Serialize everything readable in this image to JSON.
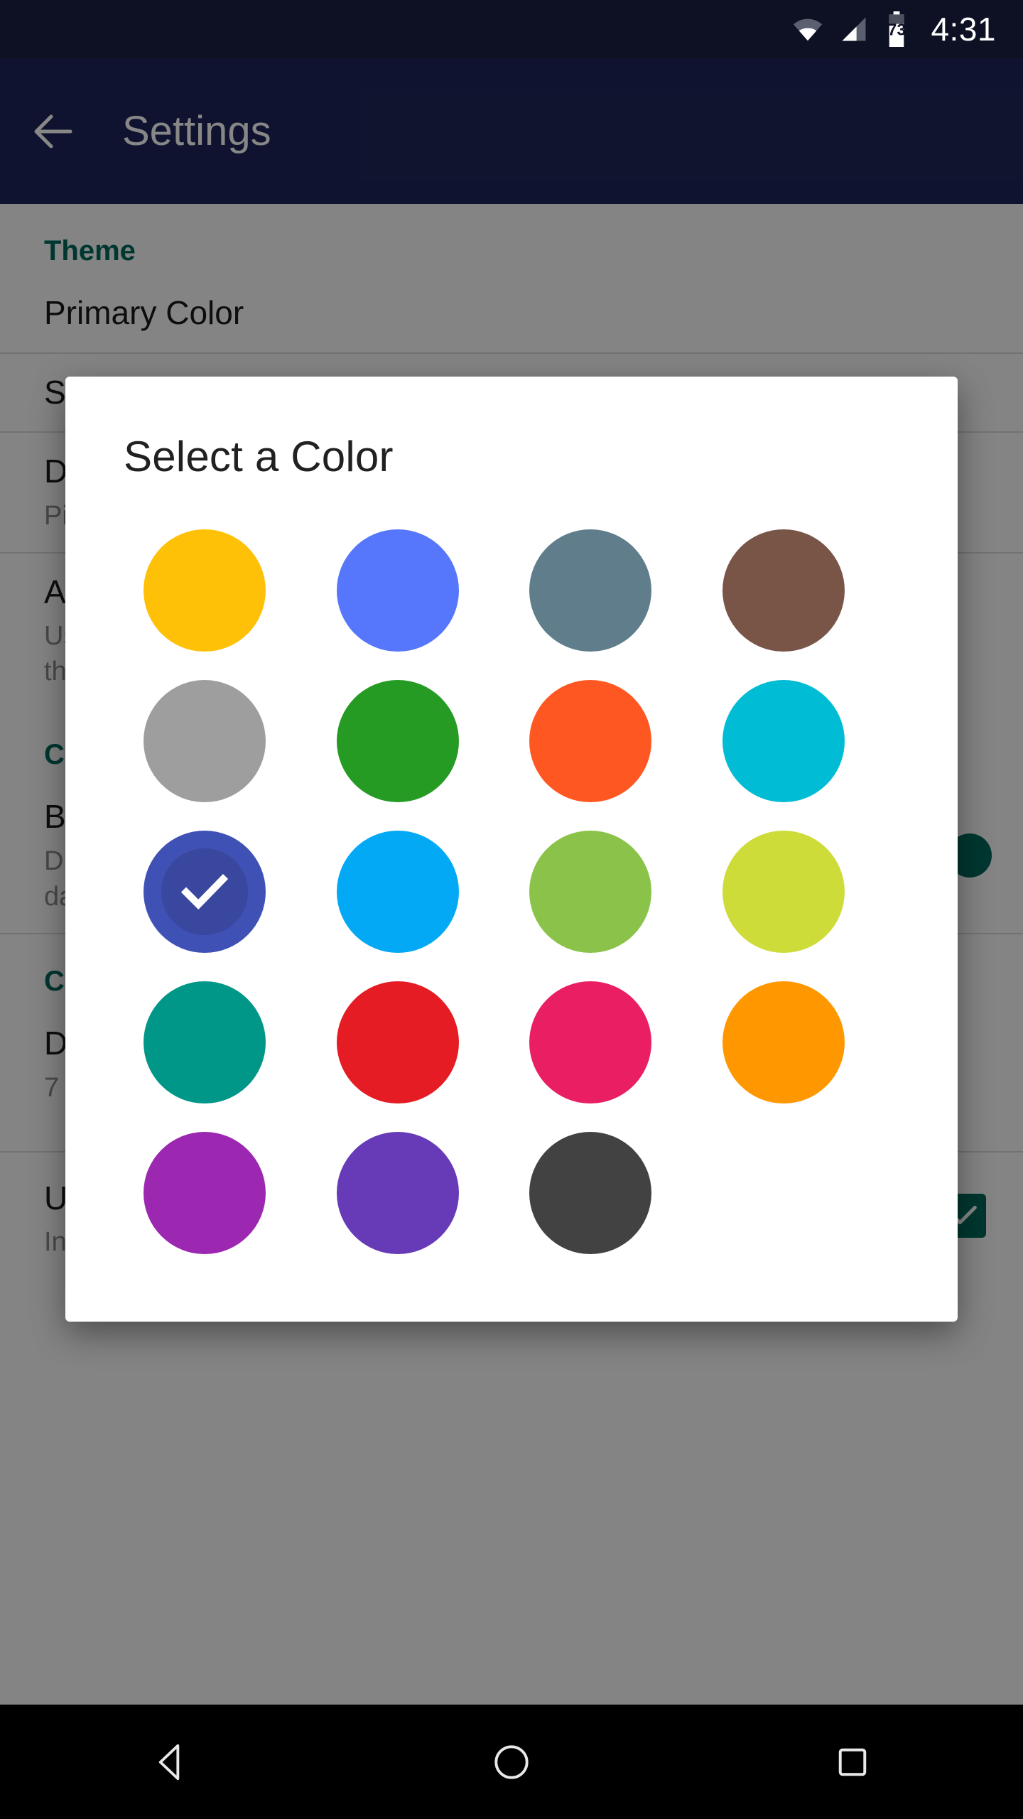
{
  "statusbar": {
    "time": "4:31",
    "battery_level": "73",
    "wifi_icon": "wifi-icon",
    "signal_icon": "cellular-signal-icon",
    "battery_icon": "battery-icon"
  },
  "toolbar": {
    "title": "Settings",
    "back_icon": "back-arrow-icon",
    "background_color": "#1e2559"
  },
  "settings": {
    "section_theme": "Theme",
    "section_color": "Color",
    "section_calendar": "Calendar view setting",
    "rows": [
      {
        "title": "Primary Color",
        "subtitle": ""
      },
      {
        "title": "Secondary Color",
        "subtitle": ""
      },
      {
        "title": "Default Event Color",
        "subtitle": "Pick a color for new events"
      },
      {
        "title": "Automatic Dark Theme",
        "subtitle": "Use dark theme automatically at night using\nthe device settings"
      },
      {
        "title": "Bold Text",
        "subtitle": "Display event titles and headers with bold\ndate text"
      },
      {
        "title": "Days in Week View",
        "subtitle": "7"
      },
      {
        "title": "Use Natural Language",
        "subtitle": "Insert events using Natural Language Processing"
      }
    ],
    "section_header_color": "#00695c",
    "accent_color": "#00695c"
  },
  "dialog": {
    "title": "Select a Color",
    "selected_index": 8,
    "selected_color": "#3f51b5",
    "selected_inner_color": "#39479e",
    "check_icon": "check-icon",
    "swatches": [
      {
        "name": "amber",
        "hex": "#ffc107",
        "selected": false
      },
      {
        "name": "blue",
        "hex": "#5677fc",
        "selected": false
      },
      {
        "name": "blue-grey",
        "hex": "#607d8b",
        "selected": false
      },
      {
        "name": "brown",
        "hex": "#795548",
        "selected": false
      },
      {
        "name": "grey",
        "hex": "#9e9e9e",
        "selected": false
      },
      {
        "name": "green",
        "hex": "#259b24",
        "selected": false
      },
      {
        "name": "deep-orange",
        "hex": "#ff5722",
        "selected": false
      },
      {
        "name": "cyan",
        "hex": "#00bcd4",
        "selected": false
      },
      {
        "name": "indigo",
        "hex": "#3f51b5",
        "selected": true
      },
      {
        "name": "light-blue",
        "hex": "#03a9f4",
        "selected": false
      },
      {
        "name": "light-green",
        "hex": "#8bc34a",
        "selected": false
      },
      {
        "name": "lime",
        "hex": "#cddc39",
        "selected": false
      },
      {
        "name": "teal",
        "hex": "#009688",
        "selected": false
      },
      {
        "name": "red",
        "hex": "#e51c23",
        "selected": false
      },
      {
        "name": "pink",
        "hex": "#e91e63",
        "selected": false
      },
      {
        "name": "orange",
        "hex": "#ff9800",
        "selected": false
      },
      {
        "name": "purple",
        "hex": "#9c27b0",
        "selected": false
      },
      {
        "name": "deep-purple",
        "hex": "#673ab7",
        "selected": false
      },
      {
        "name": "black",
        "hex": "#424242",
        "selected": false
      }
    ]
  },
  "navbar": {
    "back_icon": "nav-back-triangle-icon",
    "home_icon": "nav-home-circle-icon",
    "recents_icon": "nav-recents-square-icon"
  }
}
